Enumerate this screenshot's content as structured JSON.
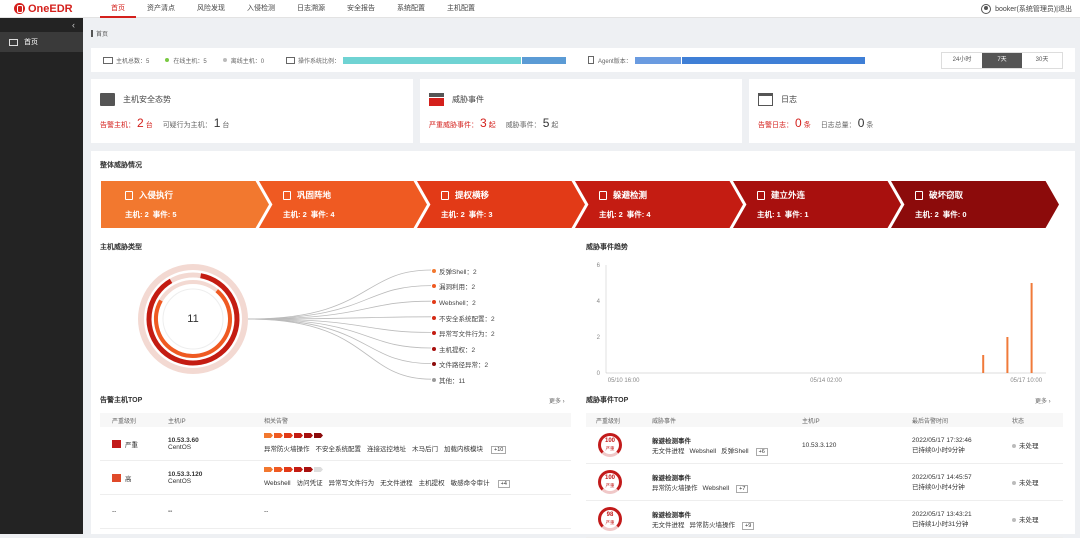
{
  "brand": {
    "name": "OneEDR"
  },
  "nav": [
    "首页",
    "资产清点",
    "风险发现",
    "入侵检测",
    "日志溯源",
    "安全报告",
    "系统配置",
    "主机配置"
  ],
  "user": {
    "label": "booker(系统管理员)",
    "logout": "|退出"
  },
  "sidebar": {
    "collapse": "‹",
    "items": [
      {
        "label": "首页"
      }
    ]
  },
  "breadcrumb": "首页",
  "stats": {
    "hosts_total": "主机总数：5",
    "online": "在线主机：5",
    "offline": "离线主机：0",
    "os_label": "操作系统比例：",
    "agent_label": "Agent版本：",
    "os_ratio": [
      {
        "value": 0.8,
        "color": "#6fd3d3"
      },
      {
        "value": 0.2,
        "color": "#5b9bd5"
      }
    ],
    "agent_ratio": [
      {
        "value": 0.2,
        "color": "#6a9be0"
      },
      {
        "value": 0.8,
        "color": "#3f7fd6"
      }
    ],
    "ranges": [
      "24小时",
      "7天",
      "30天"
    ],
    "active_range": 1
  },
  "cards": [
    {
      "title": "主机安全态势",
      "a_label": "告警主机：",
      "a_value": "2",
      "a_unit": "台",
      "b_label": "可疑行为主机：",
      "b_value": "1",
      "b_unit": "台"
    },
    {
      "title": "威胁事件",
      "a_label": "严重威胁事件：",
      "a_value": "3",
      "a_unit": "起",
      "b_label": "威胁事件：",
      "b_value": "5",
      "b_unit": "起"
    },
    {
      "title": "日志",
      "a_label": "告警日志：",
      "a_value": "0",
      "a_unit": "条",
      "b_label": "日志总量：",
      "b_value": "0",
      "b_unit": "条"
    }
  ],
  "overview": {
    "title": "整体威胁情况",
    "stages": [
      {
        "name": "入侵执行",
        "host": "主机: 2",
        "event": "事件: 5",
        "color": "#f2782f"
      },
      {
        "name": "巩固阵地",
        "host": "主机: 2",
        "event": "事件: 4",
        "color": "#ef5a22"
      },
      {
        "name": "提权横移",
        "host": "主机: 2",
        "event": "事件: 3",
        "color": "#e23a17"
      },
      {
        "name": "躲避检测",
        "host": "主机: 2",
        "event": "事件: 4",
        "color": "#c41c12"
      },
      {
        "name": "建立外连",
        "host": "主机: 1",
        "event": "事件: 1",
        "color": "#a8100e"
      },
      {
        "name": "破坏窃取",
        "host": "主机: 2",
        "event": "事件: 0",
        "color": "#8c0b0b"
      }
    ]
  },
  "host_threat_types": {
    "title": "主机威胁类型",
    "total": "11",
    "items": [
      {
        "label": "反弹Shell：2",
        "color": "#f2782f"
      },
      {
        "label": "漏洞利用：2",
        "color": "#ef5a22"
      },
      {
        "label": "Webshell：2",
        "color": "#e23a17"
      },
      {
        "label": "不安全系统配置：2",
        "color": "#d42a15"
      },
      {
        "label": "异常写文件行为：2",
        "color": "#c41c12"
      },
      {
        "label": "主机提权：2",
        "color": "#a8100e"
      },
      {
        "label": "文件路径异常：2",
        "color": "#8c0b0b"
      },
      {
        "label": "其他：11",
        "color": "#999999"
      }
    ]
  },
  "chart_data": {
    "type": "bar",
    "title": "威胁事件趋势",
    "x_ticks": [
      "05/10 16:00",
      "05/14 02:00",
      "05/17 10:00"
    ],
    "y_ticks": [
      "0",
      "2",
      "4",
      "6"
    ],
    "ylim": [
      0,
      6
    ],
    "bars": [
      {
        "x": 0.855,
        "value": 1
      },
      {
        "x": 0.91,
        "value": 2
      },
      {
        "x": 0.965,
        "value": 5
      }
    ],
    "color": "#f07a3a"
  },
  "alert_hosts": {
    "title": "告警主机TOP",
    "more": "更多 ›",
    "headers": [
      "严重级别",
      "主机IP",
      "相关告警"
    ],
    "rows": [
      {
        "level": "严重",
        "ip": "10.53.3.60",
        "os": "CentOS",
        "tags": [
          "异常防火墙操作",
          "不安全系统配置",
          "连接远控地址",
          "木马后门",
          "加载内核模块"
        ],
        "extra": "+10",
        "sev": [
          1,
          1,
          1,
          1,
          1,
          1
        ]
      },
      {
        "level": "高",
        "ip": "10.53.3.120",
        "os": "CentOS",
        "tags": [
          "Webshell",
          "访问凭证",
          "异常写文件行为",
          "无文件进程",
          "主机提权",
          "敏感命令审计"
        ],
        "extra": "+4",
        "sev": [
          1,
          1,
          1,
          1,
          1,
          0
        ]
      },
      {
        "level": "--",
        "ip": "--",
        "os": "",
        "tags": [
          "--"
        ],
        "extra": "",
        "sev": []
      }
    ]
  },
  "threat_events": {
    "title": "威胁事件TOP",
    "more": "更多 ›",
    "headers": [
      "严重级别",
      "威胁事件",
      "主机IP",
      "最后告警时间",
      "状态"
    ],
    "rows": [
      {
        "score": "100",
        "sev": "严重",
        "name": "躲避检测事件",
        "tags": [
          "无文件进程",
          "Webshell",
          "反弹Shell"
        ],
        "extra": "+6",
        "ip": "10.53.3.120",
        "time": "2022/05/17 17:32:46",
        "dur": "已持续0小时9分钟",
        "status": "未处理"
      },
      {
        "score": "100",
        "sev": "严重",
        "name": "躲避检测事件",
        "tags": [
          "异常防火墙操作",
          "Webshell"
        ],
        "extra": "+7",
        "ip": "",
        "time": "2022/05/17 14:45:57",
        "dur": "已持续0小时4分钟",
        "status": "未处理"
      },
      {
        "score": "98",
        "sev": "严重",
        "name": "躲避检测事件",
        "tags": [
          "无文件进程",
          "异常防火墙操作"
        ],
        "extra": "+9",
        "ip": "",
        "time": "2022/05/17 13:43:21",
        "dur": "已持续1小时31分钟",
        "status": "未处理"
      }
    ]
  }
}
